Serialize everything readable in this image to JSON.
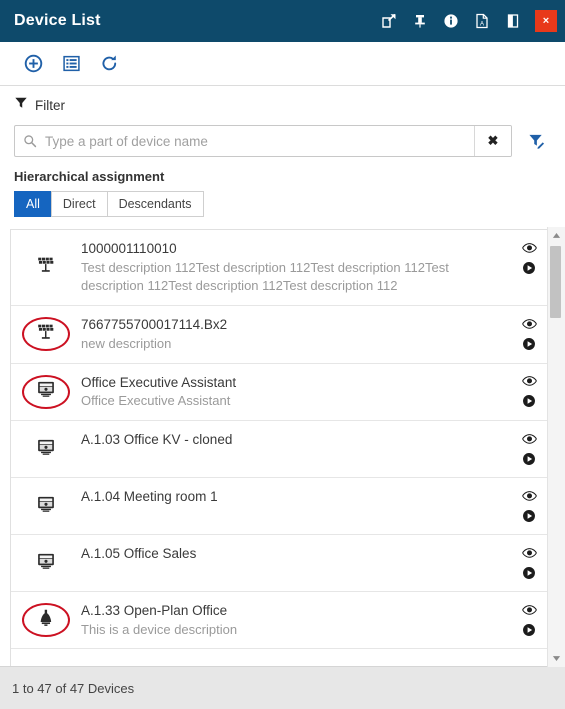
{
  "window": {
    "title": "Device List",
    "title_actions": [
      {
        "name": "open-in-new-window-icon",
        "label": "Open in new window"
      },
      {
        "name": "pin-icon",
        "label": "Pin"
      },
      {
        "name": "info-icon",
        "label": "Info"
      },
      {
        "name": "pdf-export-icon",
        "label": "Export PDF"
      },
      {
        "name": "sidebar-toggle-icon",
        "label": "Toggle panel"
      }
    ],
    "close_label": "×",
    "accent_color": "#0e4a6b",
    "close_color": "#e8391a"
  },
  "toolbar": {
    "buttons": [
      {
        "name": "add-device-button",
        "label": "Add"
      },
      {
        "name": "list-view-button",
        "label": "List view"
      },
      {
        "name": "refresh-button",
        "label": "Refresh"
      }
    ],
    "icon_color": "#2060a8"
  },
  "filter": {
    "heading": "Filter",
    "search": {
      "placeholder": "Type a part of device name",
      "value": "",
      "clear_label": "✖"
    },
    "advanced_filter_label": "Advanced filter",
    "hierarchical_label": "Hierarchical assignment",
    "segments": [
      {
        "label": "All",
        "active": true
      },
      {
        "label": "Direct",
        "active": false
      },
      {
        "label": "Descendants",
        "active": false
      }
    ],
    "active_segment_color": "#1565c0"
  },
  "list": {
    "row_actions": [
      {
        "name": "view-icon",
        "label": "View"
      },
      {
        "name": "run-icon",
        "label": "Run"
      }
    ],
    "highlight_color": "#cc1122",
    "items": [
      {
        "title": "1000001110010",
        "description": "Test description 112Test description 112Test description 112Test description 112Test description 112Test description 112",
        "icon": "solar-panel-device-icon",
        "highlighted": false
      },
      {
        "title": "7667755700017114.Bx2",
        "description": "new description",
        "icon": "solar-panel-device-icon",
        "highlighted": true
      },
      {
        "title": "Office Executive Assistant",
        "description": "Office Executive Assistant",
        "icon": "panel-device-icon",
        "highlighted": true
      },
      {
        "title": "A.1.03 Office KV - cloned",
        "description": "",
        "icon": "panel-device-icon",
        "highlighted": false
      },
      {
        "title": "A.1.04 Meeting room 1",
        "description": "",
        "icon": "panel-device-icon",
        "highlighted": false
      },
      {
        "title": "A.1.05 Office Sales",
        "description": "",
        "icon": "panel-device-icon",
        "highlighted": false
      },
      {
        "title": "A.1.33 Open-Plan Office",
        "description": "This is a device description",
        "icon": "lamp-device-icon",
        "highlighted": true
      }
    ]
  },
  "scrollbar": {
    "up_label": "▲",
    "down_label": "▼"
  },
  "status": {
    "text": "1 to 47 of 47 Devices"
  }
}
